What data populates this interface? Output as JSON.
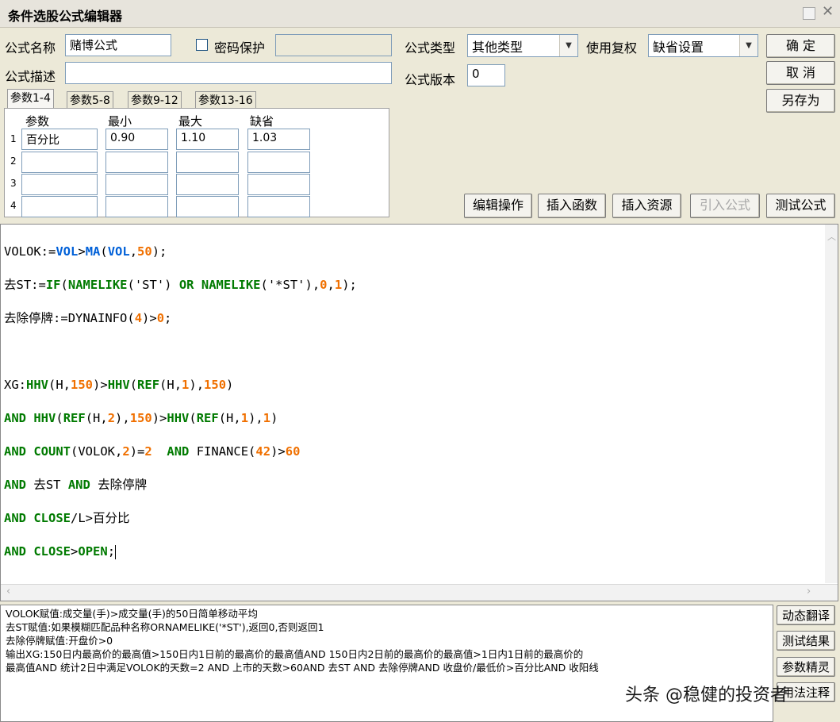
{
  "window": {
    "title": "条件选股公式编辑器"
  },
  "form": {
    "name_label": "公式名称",
    "name_value": "赌博公式",
    "password_label": "密码保护",
    "password_value": "",
    "desc_label": "公式描述",
    "desc_value": "",
    "type_label": "公式类型",
    "type_value": "其他类型",
    "fq_label": "使用复权",
    "fq_value": "缺省设置",
    "version_label": "公式版本",
    "version_value": "0"
  },
  "buttons": {
    "ok": "确  定",
    "cancel": "取  消",
    "save_as": "另存为",
    "edit_ops": "编辑操作",
    "insert_func": "插入函数",
    "insert_res": "插入资源",
    "import_formula": "引入公式",
    "test_formula": "测试公式"
  },
  "tabs": [
    "参数1-4",
    "参数5-8",
    "参数9-12",
    "参数13-16"
  ],
  "params": {
    "headers": [
      "参数",
      "最小",
      "最大",
      "缺省"
    ],
    "rows": [
      {
        "num": "1",
        "name": "百分比",
        "min": "0.90",
        "max": "1.10",
        "def": "1.03"
      },
      {
        "num": "2",
        "name": "",
        "min": "",
        "max": "",
        "def": ""
      },
      {
        "num": "3",
        "name": "",
        "min": "",
        "max": "",
        "def": ""
      },
      {
        "num": "4",
        "name": "",
        "min": "",
        "max": "",
        "def": ""
      }
    ]
  },
  "code": {
    "l1": [
      "VOLOK",
      ":=",
      "VOL",
      ">",
      "MA",
      "(",
      "VOL",
      ",",
      "50",
      ");"
    ],
    "l2": [
      "去ST",
      ":=",
      "IF",
      "(",
      "NAMELIKE",
      "('ST') ",
      "OR",
      " ",
      "NAMELIKE",
      "('*ST'),",
      "0",
      ",",
      "1",
      ");"
    ],
    "l3": [
      "去除停牌",
      ":=",
      "DYNAINFO",
      "(",
      "4",
      ")>",
      "0",
      ";"
    ],
    "l4": [
      "XG",
      ":",
      "HHV",
      "(H,",
      "150",
      ")>",
      "HHV",
      "(",
      "REF",
      "(H,",
      "1",
      "),",
      "150",
      ")"
    ],
    "l5": [
      "AND",
      " ",
      "HHV",
      "(",
      "REF",
      "(H,",
      "2",
      "),",
      "150",
      ")>",
      "HHV",
      "(",
      "REF",
      "(H,",
      "1",
      "),",
      "1",
      ")"
    ],
    "l6": [
      "AND",
      " ",
      "COUNT",
      "(VOLOK,",
      "2",
      ")=",
      "2",
      "  ",
      "AND",
      " ",
      "FINANCE",
      "(",
      "42",
      ")>",
      "60"
    ],
    "l7": [
      "AND",
      " 去ST ",
      "AND",
      " 去除停牌"
    ],
    "l8": [
      "AND",
      " ",
      "CLOSE",
      "/L>百分比"
    ],
    "l9": [
      "AND",
      " ",
      "CLOSE",
      ">",
      "OPEN",
      ";"
    ]
  },
  "description": [
    "VOLOK赋值:成交量(手)>成交量(手)的50日简单移动平均",
    "去ST赋值:如果模糊匹配品种名称ORNAMELIKE('*ST'),返回0,否则返回1",
    "去除停牌赋值:开盘价>0",
    "输出XG:150日内最高价的最高值>150日内1日前的最高价的最高值AND 150日内2日前的最高价的最高值>1日内1日前的最高价的",
    "最高值AND  统计2日中满足VOLOK的天数=2  AND 上市的天数>60AND 去ST AND 去除停牌AND 收盘价/最低价>百分比AND 收阳线"
  ],
  "side_buttons": [
    "动态翻译",
    "测试结果",
    "参数精灵",
    "用法注释"
  ],
  "watermark": "头条 @稳健的投资者"
}
